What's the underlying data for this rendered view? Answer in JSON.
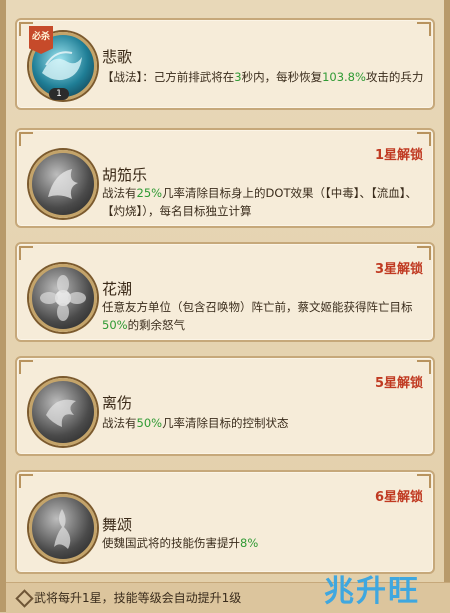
{
  "skills": [
    {
      "name": "悲歌",
      "icon": "wave-skill-icon",
      "badge": "必杀",
      "level": "1",
      "desc_parts": [
        {
          "t": "【战法】：己方前排武将在"
        },
        {
          "t": "3",
          "hl": true
        },
        {
          "t": "秒内，每秒恢复"
        },
        {
          "t": "103.8%",
          "hl": true
        },
        {
          "t": "攻击的兵力"
        }
      ],
      "unlock": ""
    },
    {
      "name": "胡笳乐",
      "icon": "beast-skill-icon",
      "desc_parts": [
        {
          "t": "战法有"
        },
        {
          "t": "25%",
          "hl": true
        },
        {
          "t": "几率清除目标身上的DOT效果（【中毒】、【流血】、【灼烧】），每名目标独立计算"
        }
      ],
      "unlock": "1星解锁"
    },
    {
      "name": "花潮",
      "icon": "flower-skill-icon",
      "desc_parts": [
        {
          "t": "任意友方单位（包含召唤物）阵亡前，蔡文姬能获得阵亡目标"
        },
        {
          "t": "50%",
          "hl": true
        },
        {
          "t": "的剩余怒气"
        }
      ],
      "unlock": "3星解锁"
    },
    {
      "name": "离伤",
      "icon": "storm-skill-icon",
      "desc_parts": [
        {
          "t": "战法有"
        },
        {
          "t": "50%",
          "hl": true
        },
        {
          "t": "几率清除目标的控制状态"
        }
      ],
      "unlock": "5星解锁"
    },
    {
      "name": "舞颂",
      "icon": "dancer-skill-icon",
      "desc_parts": [
        {
          "t": "使魏国武将的技能伤害提升"
        },
        {
          "t": "8%",
          "hl": true
        }
      ],
      "unlock": "6星解锁"
    }
  ],
  "footer": {
    "text": "武将每升1星，技能等级会自动提升1级"
  },
  "watermark": "兆升旺",
  "colors": {
    "highlight": "#2f9a34",
    "unlock": "#c03a22",
    "card_bg": "#f6ecd9"
  }
}
